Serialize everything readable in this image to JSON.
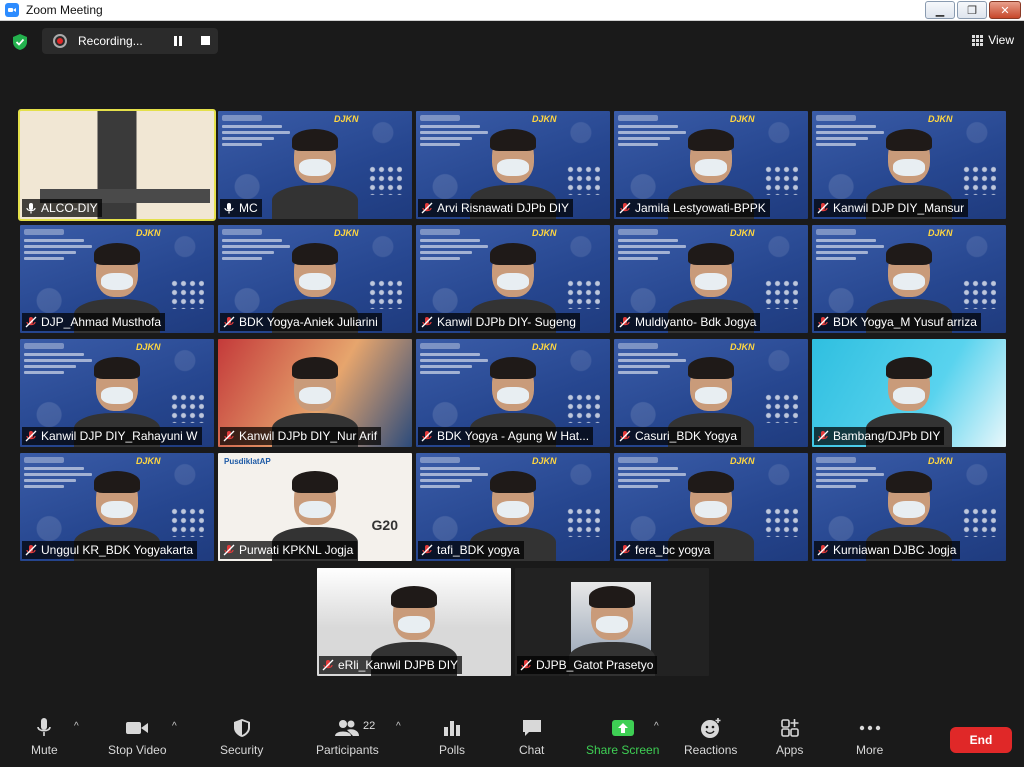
{
  "window": {
    "title": "Zoom Meeting",
    "app_color": "#2d8cff"
  },
  "recording": {
    "label": "Recording..."
  },
  "view": {
    "label": "View"
  },
  "participants_grid": [
    {
      "name": "ALCO-DIY",
      "style": "office",
      "active": true,
      "mic": "on"
    },
    {
      "name": "MC",
      "style": "bg",
      "mic": "on"
    },
    {
      "name": "Arvi Risnawati DJPb DIY",
      "style": "bg",
      "mic": "off"
    },
    {
      "name": "Jamila Lestyowati-BPPK",
      "style": "bg",
      "mic": "off"
    },
    {
      "name": "Kanwil DJP DIY_Mansur",
      "style": "bg",
      "mic": "off"
    },
    {
      "name": "DJP_Ahmad Musthofa",
      "style": "bg",
      "mic": "off"
    },
    {
      "name": "BDK Yogya-Aniek Juliarini",
      "style": "bg",
      "mic": "off"
    },
    {
      "name": "Kanwil DJPb DIY- Sugeng",
      "style": "bg",
      "mic": "off"
    },
    {
      "name": "Muldiyanto- Bdk Jogya",
      "style": "bg",
      "mic": "off"
    },
    {
      "name": "BDK Yogya_M Yusuf arriza",
      "style": "bg",
      "mic": "off"
    },
    {
      "name": "Kanwil DJP DIY_Rahayuni W",
      "style": "bg",
      "mic": "off"
    },
    {
      "name": "Kanwil DJPb DIY_Nur Arif",
      "style": "red",
      "mic": "off"
    },
    {
      "name": "BDK Yogya - Agung W Hat...",
      "style": "bg",
      "mic": "off"
    },
    {
      "name": "Casuri_BDK Yogya",
      "style": "bg",
      "mic": "off"
    },
    {
      "name": "Bambang/DJPb DIY",
      "style": "cyan",
      "mic": "off"
    },
    {
      "name": "Unggul KR_BDK Yogyakarta",
      "style": "bg",
      "mic": "off"
    },
    {
      "name": "Purwati KPKNL Jogja",
      "style": "poster",
      "mic": "off"
    },
    {
      "name": "tafi_BDK yogya",
      "style": "bg",
      "mic": "off"
    },
    {
      "name": "fera_bc yogya",
      "style": "bg",
      "mic": "off"
    },
    {
      "name": "Kurniawan DJBC Jogja",
      "style": "bg",
      "mic": "off"
    },
    {
      "name": "eRli_Kanwil DJPB DIY",
      "style": "grey",
      "mic": "off"
    },
    {
      "name": "DJPB_Gatot Prasetyo",
      "style": "office",
      "mic": "off"
    }
  ],
  "slide_brand": "DJKN",
  "poster_texts": {
    "pusdiklat": "PusdiklatAP",
    "g20": "G20"
  },
  "toolbar": {
    "mute": "Mute",
    "stop_video": "Stop Video",
    "security": "Security",
    "participants": "Participants",
    "participants_count": "22",
    "polls": "Polls",
    "chat": "Chat",
    "share_screen": "Share Screen",
    "reactions": "Reactions",
    "apps": "Apps",
    "more": "More",
    "end": "End"
  },
  "colors": {
    "share_green": "#3ecf54",
    "end_red": "#e02828",
    "active_speaker": "#e4e04a",
    "slide_blue": "#26468f"
  }
}
